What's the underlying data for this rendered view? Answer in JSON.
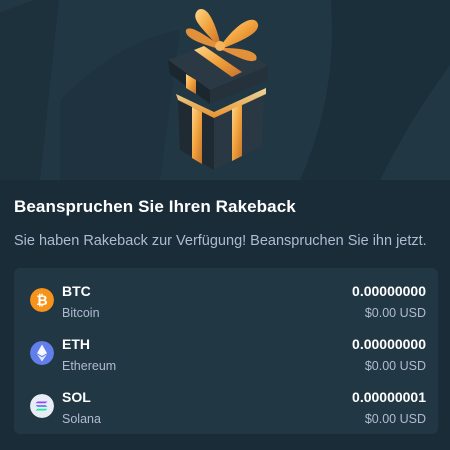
{
  "title": "Beanspruchen Sie Ihren Rakeback",
  "subtitle": "Sie haben Rakeback zur Verfügung! Beanspruchen Sie ihn jetzt.",
  "colors": {
    "background": "#1a2c38",
    "panel": "#213743",
    "text_primary": "#ffffff",
    "text_secondary": "#b1bad3",
    "btc": "#f7931a",
    "eth": "#627eea",
    "sol": "#e8ecf5"
  },
  "coins": [
    {
      "symbol": "BTC",
      "name": "Bitcoin",
      "amount": "0.00000000",
      "usd": "$0.00 USD",
      "icon": "bitcoin-icon"
    },
    {
      "symbol": "ETH",
      "name": "Ethereum",
      "amount": "0.00000000",
      "usd": "$0.00 USD",
      "icon": "ethereum-icon"
    },
    {
      "symbol": "SOL",
      "name": "Solana",
      "amount": "0.00000001",
      "usd": "$0.00 USD",
      "icon": "solana-icon"
    }
  ]
}
